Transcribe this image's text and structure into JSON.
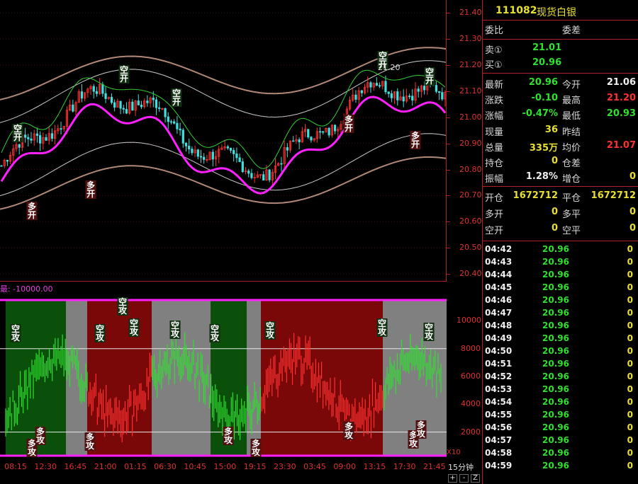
{
  "instrument": {
    "code": "111082",
    "name": "现货白银"
  },
  "order_book": {
    "wei_bi_label": "委比",
    "wei_cha_label": "委差",
    "sell_label": "卖①",
    "sell_price": "21.01",
    "buy_label": "买①",
    "buy_price": "20.96"
  },
  "quote": {
    "latest_label": "最新",
    "latest": "20.96",
    "open_label": "今开",
    "open": "21.06",
    "change_label": "涨跌",
    "change": "-0.10",
    "high_label": "最高",
    "high": "21.20",
    "pct_label": "涨幅",
    "pct": "-0.47%",
    "low_label": "最低",
    "low": "20.93",
    "volume_label": "现量",
    "volume": "36",
    "prev_label": "昨结",
    "total_label": "总量",
    "total": "335万",
    "avg_label": "均价",
    "avg": "21.07",
    "hold_label": "持仓",
    "hold": "0",
    "holddiff_label": "仓差",
    "amp_label": "振幅",
    "amp": "1.28%",
    "addpos_label": "增仓",
    "addpos": "0"
  },
  "positions": {
    "open_label": "开仓",
    "open": "1672712",
    "close_label": "平仓",
    "close": "1672712",
    "long_open_label": "多开",
    "long_open": "0",
    "long_close_label": "多平",
    "long_close": "0",
    "short_open_label": "空开",
    "short_open": "0",
    "short_close_label": "空平",
    "short_close": "0"
  },
  "ticks": [
    {
      "time": "04:42",
      "price": "20.96",
      "vol": "0"
    },
    {
      "time": "04:43",
      "price": "20.96",
      "vol": "0"
    },
    {
      "time": "04:44",
      "price": "20.96",
      "vol": "0"
    },
    {
      "time": "04:45",
      "price": "20.96",
      "vol": "0"
    },
    {
      "time": "04:46",
      "price": "20.96",
      "vol": "0"
    },
    {
      "time": "04:47",
      "price": "20.96",
      "vol": "0"
    },
    {
      "time": "04:48",
      "price": "20.96",
      "vol": "0"
    },
    {
      "time": "04:49",
      "price": "20.96",
      "vol": "0"
    },
    {
      "time": "04:50",
      "price": "20.96",
      "vol": "0"
    },
    {
      "time": "04:51",
      "price": "20.96",
      "vol": "0"
    },
    {
      "time": "04:52",
      "price": "20.96",
      "vol": "0"
    },
    {
      "time": "04:53",
      "price": "20.96",
      "vol": "0"
    },
    {
      "time": "04:54",
      "price": "20.96",
      "vol": "0"
    },
    {
      "time": "04:55",
      "price": "20.96",
      "vol": "0"
    },
    {
      "time": "04:56",
      "price": "20.96",
      "vol": "0"
    },
    {
      "time": "04:57",
      "price": "20.96",
      "vol": "0"
    },
    {
      "time": "04:58",
      "price": "20.96",
      "vol": "0"
    },
    {
      "time": "04:59",
      "price": "20.96",
      "vol": "0"
    }
  ],
  "chart": {
    "price_ticks": [
      "21.40",
      "21.30",
      "21.20",
      "21.10",
      "21.00",
      "20.90",
      "20.80",
      "20.70",
      "20.60",
      "20.50",
      "20.40"
    ],
    "price_range": [
      20.37,
      21.45
    ],
    "high_marker": "21.20",
    "indicator_title": "最: -10000.00",
    "indicator_ticks": [
      "10000",
      "8000",
      "6000",
      "4000",
      "2000"
    ],
    "indicator_range": [
      0,
      11500
    ],
    "x10_label": "X10",
    "time_labels": [
      "08:15",
      "12:30",
      "16:45",
      "21:00",
      "01:15",
      "06:30",
      "10:45",
      "15:00",
      "19:15",
      "23:30",
      "03:45",
      "09:00",
      "13:15",
      "17:30",
      "21:45"
    ],
    "signal_short_open": "空开",
    "signal_long_open": "多开",
    "signal_short_attack": "空攻",
    "signal_long_attack": "多攻",
    "period": "15分钟",
    "ctrl_plus": "+",
    "ctrl_minus": "-",
    "ctrl_z": "Z",
    "colors": {
      "up": "#ff3030",
      "down": "#2fe02f",
      "magenta": "#ff20ff",
      "band": "#b08878"
    }
  }
}
